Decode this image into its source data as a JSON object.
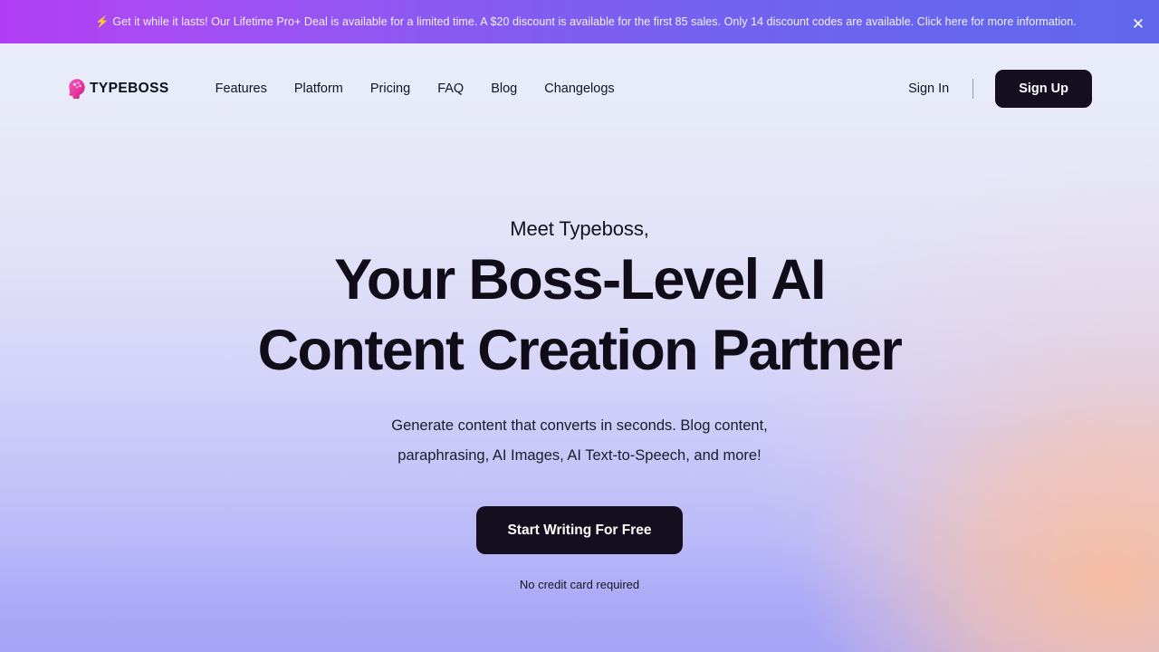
{
  "promo": {
    "icon": "lightning-bolt-icon",
    "text": "Get it while it lasts! Our Lifetime Pro+ Deal is available for a limited time. A $20 discount is available for the first 85 sales. Only 14 discount codes are available. Click here for more information.",
    "close_label": "✕",
    "gradient_from": "#b03cf5",
    "gradient_to": "#6067ec"
  },
  "header": {
    "brand": {
      "name": "TYPEBOSS",
      "mark_icon": "head-profile-icon",
      "mark_color": "#e8389a"
    },
    "nav": [
      {
        "label": "Features"
      },
      {
        "label": "Platform"
      },
      {
        "label": "Pricing"
      },
      {
        "label": "FAQ"
      },
      {
        "label": "Blog"
      },
      {
        "label": "Changelogs"
      }
    ],
    "sign_in_label": "Sign In",
    "sign_up_label": "Sign Up",
    "button_color": "#140e1f"
  },
  "hero": {
    "eyebrow": "Meet Typeboss,",
    "title_line1": "Your Boss-Level AI",
    "title_line2": "Content Creation Partner",
    "subtitle_line1": "Generate content that converts in seconds. Blog content,",
    "subtitle_line2": "paraphrasing, AI Images, AI Text-to-Speech, and more!",
    "cta_label": "Start Writing For Free",
    "note": "No credit card required"
  }
}
